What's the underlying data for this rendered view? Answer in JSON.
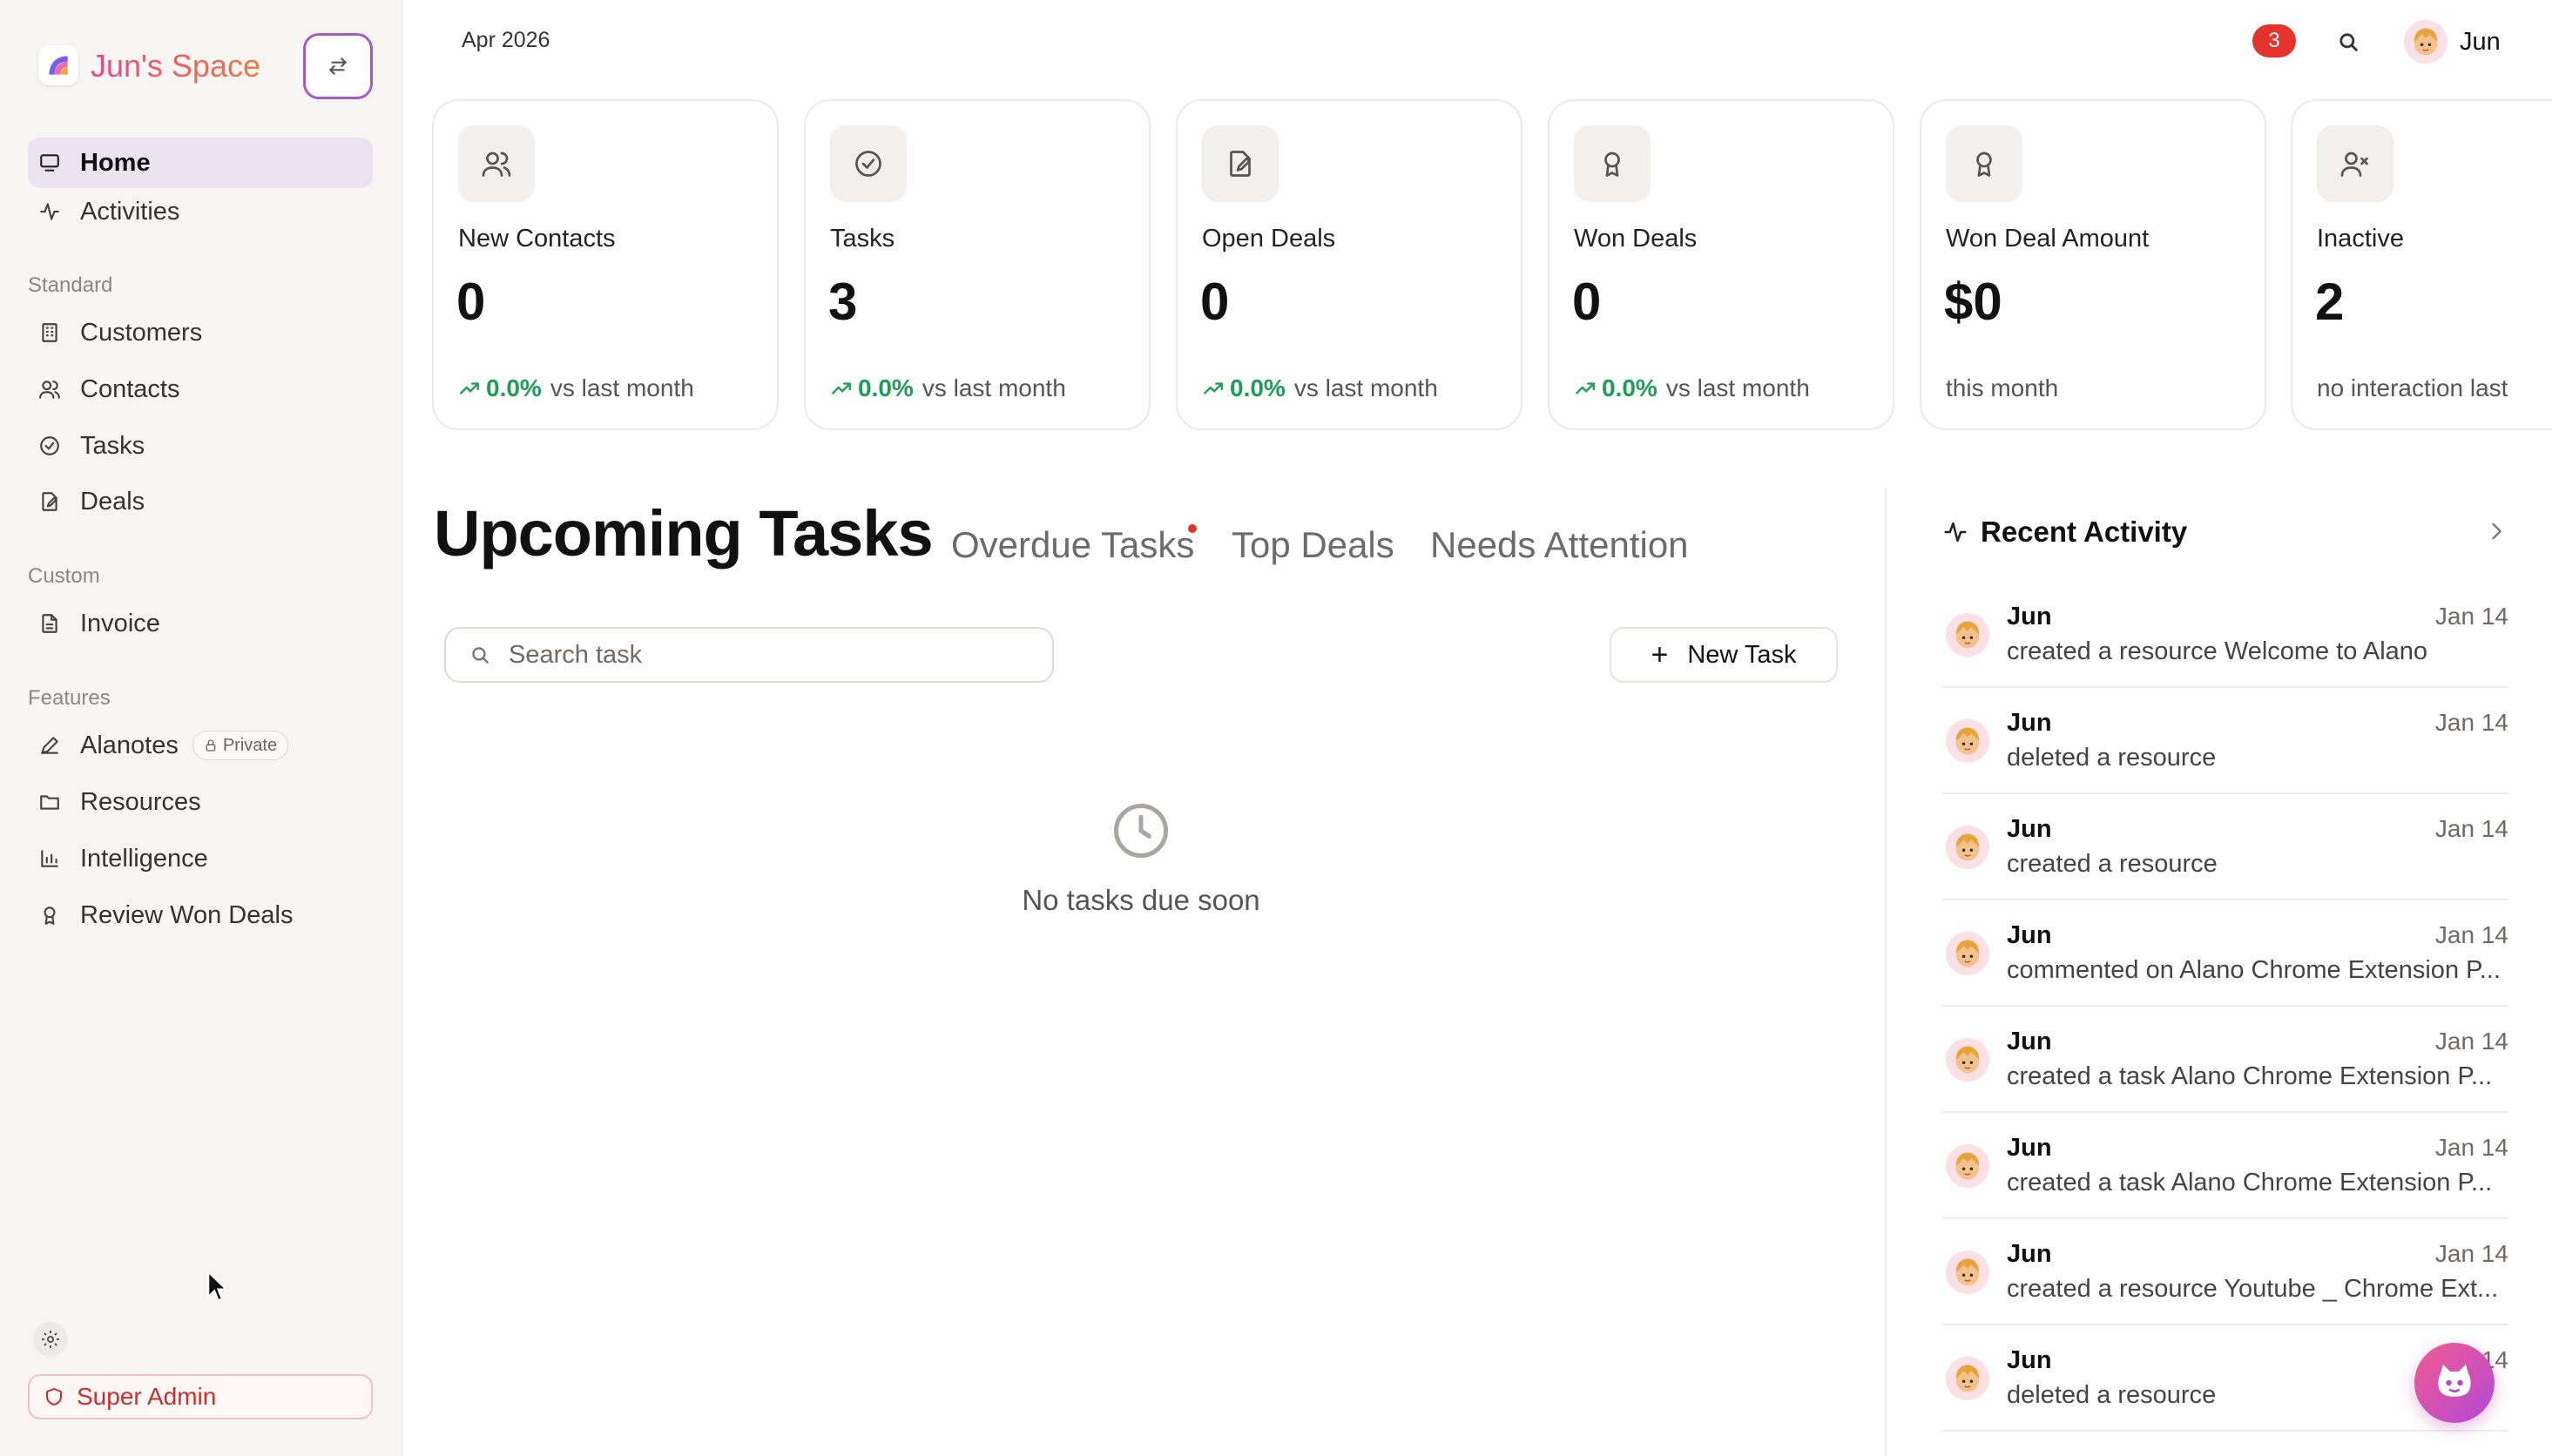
{
  "brand": {
    "name": "Jun's Space"
  },
  "sidebar": {
    "top_items": [
      {
        "label": "Home",
        "icon": "monitor-icon",
        "active": true
      },
      {
        "label": "Activities",
        "icon": "activity-icon"
      }
    ],
    "sections": [
      {
        "label": "Standard",
        "items": [
          {
            "label": "Customers",
            "icon": "building-icon"
          },
          {
            "label": "Contacts",
            "icon": "users-icon"
          },
          {
            "label": "Tasks",
            "icon": "check-circle-icon"
          },
          {
            "label": "Deals",
            "icon": "file-edit-icon"
          }
        ]
      },
      {
        "label": "Custom",
        "items": [
          {
            "label": "Invoice",
            "icon": "file-text-icon"
          }
        ]
      },
      {
        "label": "Features",
        "items": [
          {
            "label": "Alanotes",
            "icon": "pen-icon",
            "badge": "Private"
          },
          {
            "label": "Resources",
            "icon": "folder-icon"
          },
          {
            "label": "Intelligence",
            "icon": "bar-chart-icon"
          },
          {
            "label": "Review Won Deals",
            "icon": "award-icon"
          }
        ]
      }
    ],
    "super_admin_label": "Super Admin"
  },
  "header": {
    "date": "Apr 2026",
    "notifications_count": "3",
    "user_name": "Jun"
  },
  "stats": [
    {
      "title": "New Contacts",
      "value": "0",
      "pct": "0.0%",
      "foot": "vs last month",
      "icon": "users-icon"
    },
    {
      "title": "Tasks",
      "value": "3",
      "pct": "0.0%",
      "foot": "vs last month",
      "icon": "check-circle-icon"
    },
    {
      "title": "Open Deals",
      "value": "0",
      "pct": "0.0%",
      "foot": "vs last month",
      "icon": "file-edit-icon"
    },
    {
      "title": "Won Deals",
      "value": "0",
      "pct": "0.0%",
      "foot": "vs last month",
      "icon": "award-icon"
    },
    {
      "title": "Won Deal Amount",
      "value": "$0",
      "pct": "",
      "foot": "this month",
      "icon": "award-icon"
    },
    {
      "title": "Inactive",
      "value": "2",
      "pct": "",
      "foot": "no interaction last",
      "icon": "user-x-icon"
    }
  ],
  "tasks": {
    "tabs": [
      "Upcoming Tasks",
      "Overdue Tasks",
      "Top Deals",
      "Needs Attention"
    ],
    "search_placeholder": "Search task",
    "new_task_label": "New Task",
    "empty_message": "No tasks due soon"
  },
  "recent_activity": {
    "title": "Recent Activity",
    "items": [
      {
        "user": "Jun",
        "date": "Jan 14",
        "text": "created a resource Welcome to Alano"
      },
      {
        "user": "Jun",
        "date": "Jan 14",
        "text": "deleted a resource"
      },
      {
        "user": "Jun",
        "date": "Jan 14",
        "text": "created a resource"
      },
      {
        "user": "Jun",
        "date": "Jan 14",
        "text": "commented on Alano Chrome Extension P..."
      },
      {
        "user": "Jun",
        "date": "Jan 14",
        "text": "created a task Alano Chrome Extension P..."
      },
      {
        "user": "Jun",
        "date": "Jan 14",
        "text": "created a task Alano Chrome Extension P..."
      },
      {
        "user": "Jun",
        "date": "Jan 14",
        "text": "created a resource Youtube _ Chrome Ext..."
      },
      {
        "user": "Jun",
        "date": "Jan 14",
        "text": "deleted a resource"
      }
    ]
  },
  "colors": {
    "accent": "#a45ac9",
    "active_nav_bg": "#ebe3ef",
    "positive": "#1f9d55",
    "danger": "#e5322d"
  }
}
